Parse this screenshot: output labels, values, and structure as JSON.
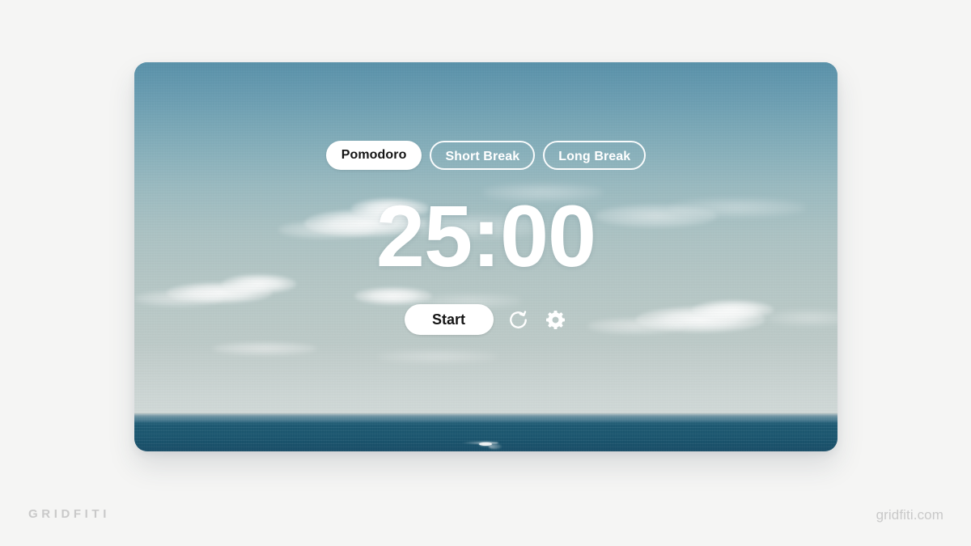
{
  "page": {
    "background_color": "#f5f5f4"
  },
  "card": {
    "background_description": "ocean horizon photo with blue sky and clouds",
    "sky_top_color": "#5a93ab",
    "sky_haze_color": "#c3cdcb",
    "sea_color": "#1a5470"
  },
  "app": {
    "mode_tabs": [
      {
        "label": "Pomodoro",
        "state": "active"
      },
      {
        "label": "Short Break",
        "state": "inactive"
      },
      {
        "label": "Long Break",
        "state": "inactive"
      }
    ],
    "timer": {
      "value": "25:00",
      "minutes": "25",
      "seconds": "00"
    },
    "controls": {
      "start_label": "Start",
      "reset_icon": "reset-circular-arrow-icon",
      "settings_icon": "gear-icon"
    },
    "colors": {
      "pill_active_bg": "#ffffff",
      "pill_active_text": "#141414",
      "pill_inactive_text": "#ffffff",
      "timer_text": "#ffffff"
    }
  },
  "footer": {
    "wordmark": "GRIDFITI",
    "url": "gridfiti.com",
    "text_color": "#c9c9c9"
  }
}
